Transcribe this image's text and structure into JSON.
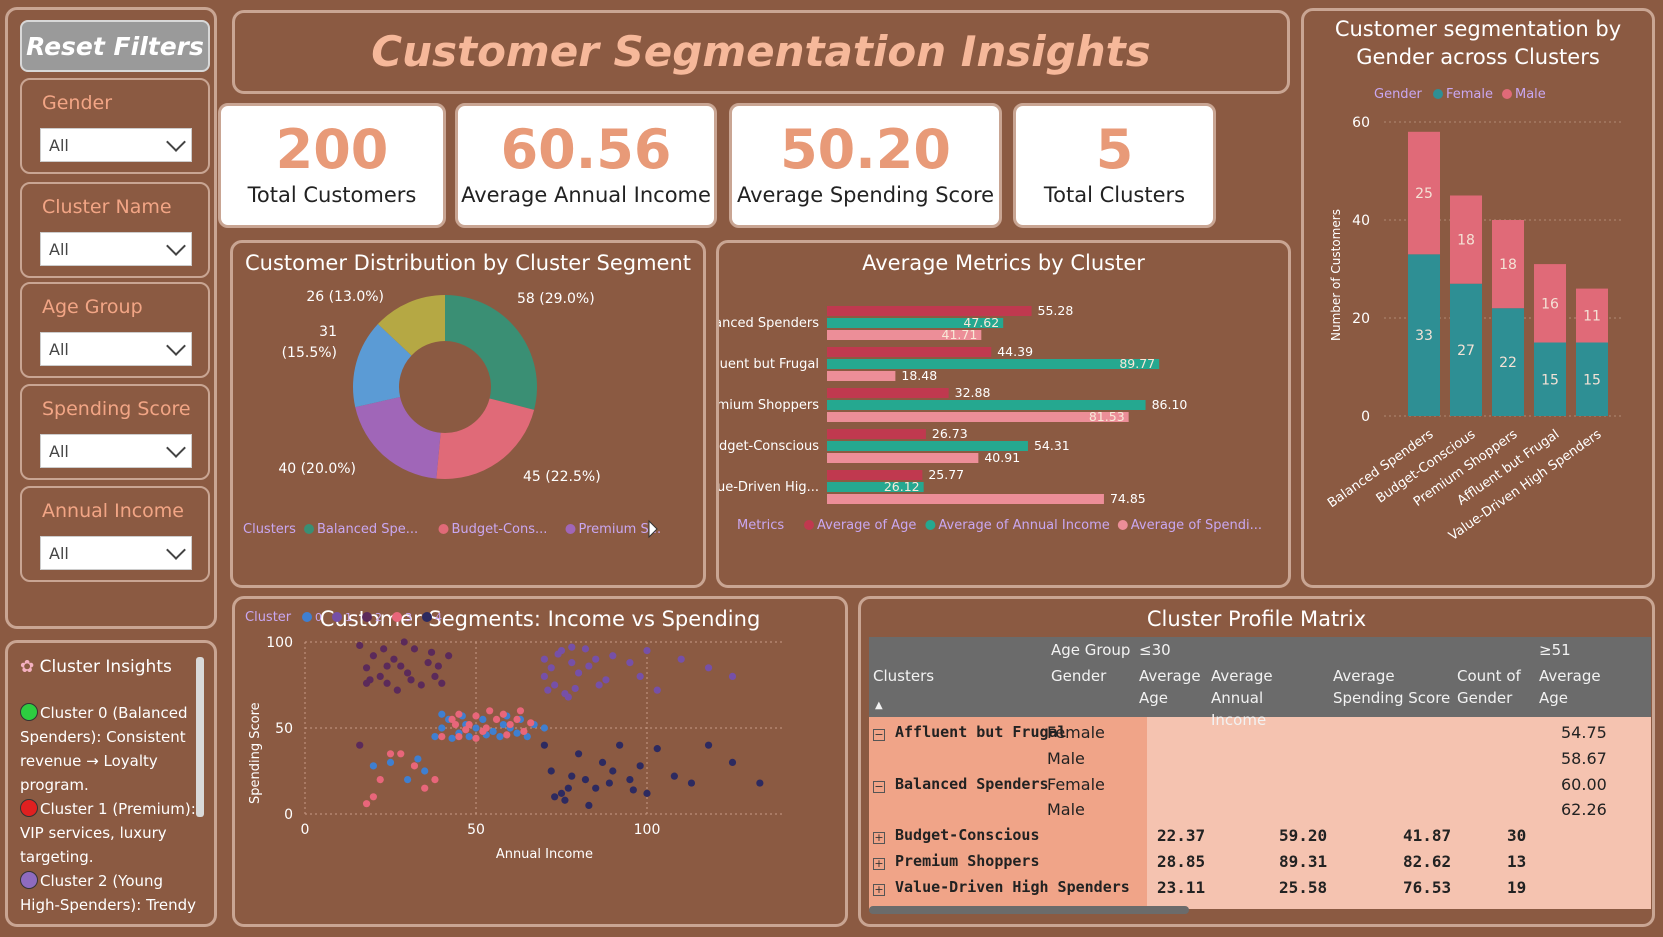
{
  "filters": {
    "reset_label": "Reset Filters",
    "items": [
      {
        "label": "Gender",
        "value": "All"
      },
      {
        "label": "Cluster Name",
        "value": "All"
      },
      {
        "label": "Age Group",
        "value": "All"
      },
      {
        "label": "Spending Score",
        "value": "All"
      },
      {
        "label": "Annual Income",
        "value": "All"
      }
    ]
  },
  "insights": {
    "title": "Cluster Insights",
    "lines": [
      {
        "color": "#2ECC40",
        "text": "Cluster 0 (Balanced Spenders): Consistent revenue → Loyalty program."
      },
      {
        "color": "#E02020",
        "text": "Cluster 1 (Premium): VIP services, luxury targeting."
      },
      {
        "color": "#8E6BBF",
        "text": "Cluster 2 (Young High-Spenders): Trendy"
      }
    ]
  },
  "header": {
    "title": "Customer Segmentation Insights"
  },
  "kpis": [
    {
      "value": "200",
      "caption": "Total Customers"
    },
    {
      "value": "60.56",
      "caption": "Average Annual Income"
    },
    {
      "value": "50.20",
      "caption": "Average Spending Score"
    },
    {
      "value": "5",
      "caption": "Total Clusters"
    }
  ],
  "donut": {
    "title": "Customer Distribution by Cluster Segment",
    "legend_title": "Clusters",
    "legend": [
      {
        "name": "Balanced Spe...",
        "color": "#3A8F74"
      },
      {
        "name": "Budget-Cons...",
        "color": "#E06A78"
      },
      {
        "name": "Premium S...",
        "color": "#A066B8"
      }
    ],
    "labels": [
      "58 (29.0%)",
      "45 (22.5%)",
      "40 (20.0%)",
      "31",
      "(15.5%)",
      "26 (13.0%)"
    ]
  },
  "metrics": {
    "title": "Average Metrics by Cluster",
    "legend_title": "Metrics",
    "legend": [
      {
        "name": "Average of Age",
        "color": "#C0394F"
      },
      {
        "name": "Average of Annual Income",
        "color": "#25A890"
      },
      {
        "name": "Average of Spendi...",
        "color": "#EC8E98"
      }
    ]
  },
  "stack": {
    "title_line1": "Customer segmentation by",
    "title_line2": "Gender across Clusters",
    "legend_title": "Gender",
    "female_label": "Female",
    "male_label": "Male",
    "ylabel": "Number of Customers"
  },
  "scatter": {
    "title": "Customer Segments: Income vs Spending",
    "legend_title": "Cluster",
    "xlabel": "Annual Income",
    "ylabel": "Spending Score"
  },
  "matrix": {
    "title": "Cluster Profile Matrix",
    "head": {
      "clusters": "Clusters",
      "age_group": "Age Group",
      "gender": "Gender",
      "age_le30": "≤30",
      "age_ge51": "≥51",
      "avg_age": "Average Age",
      "avg_income": "Average Annual Income",
      "avg_spending": "Average Spending Score",
      "count_gender": "Count of Gender",
      "avg_age2": "Average Age"
    },
    "rows": [
      {
        "cluster": "Affluent but Frugal",
        "gender": "Female",
        "age": "",
        "income": "",
        "spend": "",
        "count": "",
        "age51": "54.75"
      },
      {
        "cluster": "",
        "gender": "Male",
        "age": "",
        "income": "",
        "spend": "",
        "count": "",
        "age51": "58.67"
      },
      {
        "cluster": "Balanced Spenders",
        "gender": "Female",
        "age": "",
        "income": "",
        "spend": "",
        "count": "",
        "age51": "60.00"
      },
      {
        "cluster": "",
        "gender": "Male",
        "age": "",
        "income": "",
        "spend": "",
        "count": "",
        "age51": "62.26"
      },
      {
        "cluster": "Budget-Conscious",
        "gender": "",
        "age": "22.37",
        "income": "59.20",
        "spend": "41.87",
        "count": "30",
        "age51": ""
      },
      {
        "cluster": "Premium Shoppers",
        "gender": "",
        "age": "28.85",
        "income": "89.31",
        "spend": "82.62",
        "count": "13",
        "age51": ""
      },
      {
        "cluster": "Value-Driven High Spenders",
        "gender": "",
        "age": "23.11",
        "income": "25.58",
        "spend": "76.53",
        "count": "19",
        "age51": ""
      }
    ]
  },
  "chart_data": [
    {
      "type": "pie",
      "title": "Customer Distribution by Cluster Segment",
      "categories": [
        "Balanced Spenders",
        "Budget-Conscious",
        "Premium Shoppers",
        "Affluent but Frugal",
        "Value-Driven High Spenders"
      ],
      "values": [
        58,
        45,
        40,
        31,
        26
      ],
      "colors": [
        "#3A8F74",
        "#E06A78",
        "#A066B8",
        "#5B9BD5",
        "#B5A844"
      ]
    },
    {
      "type": "bar",
      "orientation": "horizontal",
      "title": "Average Metrics by Cluster",
      "categories": [
        "Balanced Spenders",
        "Affluent but Frugal",
        "Premium Shoppers",
        "Budget-Conscious",
        "Value-Driven Hig..."
      ],
      "series": [
        {
          "name": "Average of Age",
          "values": [
            55.28,
            44.39,
            32.88,
            26.73,
            25.77
          ]
        },
        {
          "name": "Average of Annual Income",
          "values": [
            47.62,
            89.77,
            86.1,
            54.31,
            26.12
          ]
        },
        {
          "name": "Average of Spendi...",
          "values": [
            41.71,
            18.48,
            81.53,
            40.91,
            74.85
          ]
        }
      ],
      "xlim": [
        0,
        100
      ]
    },
    {
      "type": "bar",
      "stacked": true,
      "title": "Customer segmentation by Gender across Clusters",
      "categories": [
        "Balanced Spenders",
        "Budget-Conscious",
        "Premium Shoppers",
        "Affluent but Frugal",
        "Value-Driven High Spenders"
      ],
      "series": [
        {
          "name": "Female",
          "values": [
            33,
            27,
            22,
            15,
            15
          ]
        },
        {
          "name": "Male",
          "values": [
            25,
            18,
            18,
            16,
            11
          ]
        }
      ],
      "ylabel": "Number of Customers",
      "ylim": [
        0,
        65
      ],
      "yticks": [
        0,
        20,
        40,
        60
      ]
    },
    {
      "type": "scatter",
      "title": "Customer Segments: Income vs Spending",
      "xlabel": "Annual Income",
      "ylabel": "Spending Score",
      "xlim": [
        0,
        140
      ],
      "ylim": [
        0,
        100
      ],
      "xticks": [
        0,
        50,
        100
      ],
      "yticks": [
        0,
        50,
        100
      ],
      "series": [
        {
          "name": "0",
          "color": "#3F7FD0",
          "points": [
            [
              40,
              50
            ],
            [
              42,
              55
            ],
            [
              45,
              47
            ],
            [
              47,
              52
            ],
            [
              48,
              45
            ],
            [
              50,
              50
            ],
            [
              52,
              55
            ],
            [
              55,
              48
            ],
            [
              57,
              45
            ],
            [
              58,
              52
            ],
            [
              60,
              50
            ],
            [
              62,
              47
            ],
            [
              63,
              55
            ],
            [
              65,
              45
            ],
            [
              67,
              52
            ],
            [
              70,
              50
            ],
            [
              38,
              45
            ],
            [
              20,
              28
            ],
            [
              25,
              30
            ],
            [
              30,
              20
            ],
            [
              33,
              32
            ],
            [
              35,
              25
            ],
            [
              40,
              58
            ],
            [
              43,
              44
            ],
            [
              46,
              57
            ],
            [
              53,
              46
            ],
            [
              59,
              57
            ]
          ]
        },
        {
          "name": "1",
          "color": "#7650A8",
          "points": [
            [
              70,
              90
            ],
            [
              72,
              85
            ],
            [
              75,
              95
            ],
            [
              73,
              75
            ],
            [
              76,
              70
            ],
            [
              78,
              88
            ],
            [
              80,
              82
            ],
            [
              82,
              96
            ],
            [
              85,
              90
            ],
            [
              88,
              78
            ],
            [
              70,
              80
            ],
            [
              74,
              93
            ],
            [
              77,
              68
            ],
            [
              79,
              73
            ],
            [
              83,
              86
            ],
            [
              86,
              75
            ],
            [
              90,
              92
            ],
            [
              95,
              88
            ],
            [
              100,
              95
            ],
            [
              98,
              80
            ],
            [
              103,
              72
            ],
            [
              110,
              90
            ],
            [
              118,
              85
            ],
            [
              125,
              80
            ],
            [
              78,
              97
            ],
            [
              71,
              72
            ]
          ]
        },
        {
          "name": "2",
          "color": "#5B2A5A",
          "points": [
            [
              16,
              98
            ],
            [
              18,
              85
            ],
            [
              20,
              92
            ],
            [
              22,
              80
            ],
            [
              24,
              76
            ],
            [
              26,
              90
            ],
            [
              28,
              86
            ],
            [
              30,
              82
            ],
            [
              32,
              96
            ],
            [
              34,
              75
            ],
            [
              36,
              88
            ],
            [
              38,
              80
            ],
            [
              40,
              76
            ],
            [
              42,
              92
            ],
            [
              16,
              40
            ],
            [
              19,
              78
            ],
            [
              23,
              96
            ],
            [
              27,
              72
            ],
            [
              31,
              78
            ],
            [
              37,
              94
            ],
            [
              39,
              86
            ],
            [
              24,
              86
            ],
            [
              18,
              76
            ],
            [
              29,
              100
            ]
          ]
        },
        {
          "name": "3",
          "color": "#E8667A",
          "points": [
            [
              18,
              6
            ],
            [
              20,
              10
            ],
            [
              22,
              20
            ],
            [
              25,
              35
            ],
            [
              28,
              35
            ],
            [
              32,
              28
            ],
            [
              35,
              15
            ],
            [
              38,
              20
            ],
            [
              40,
              45
            ],
            [
              43,
              55
            ],
            [
              45,
              58
            ],
            [
              48,
              52
            ],
            [
              50,
              57
            ],
            [
              53,
              50
            ],
            [
              56,
              55
            ],
            [
              58,
              58
            ],
            [
              60,
              52
            ],
            [
              62,
              55
            ],
            [
              64,
              48
            ],
            [
              66,
              53
            ],
            [
              45,
              45
            ],
            [
              50,
              44
            ],
            [
              54,
              60
            ],
            [
              59,
              46
            ],
            [
              63,
              60
            ],
            [
              52,
              48
            ],
            [
              47,
              49
            ],
            [
              44,
              52
            ]
          ]
        },
        {
          "name": "4",
          "color": "#2D2A60",
          "points": [
            [
              70,
              40
            ],
            [
              72,
              25
            ],
            [
              75,
              12
            ],
            [
              77,
              15
            ],
            [
              78,
              22
            ],
            [
              80,
              35
            ],
            [
              82,
              20
            ],
            [
              85,
              15
            ],
            [
              87,
              30
            ],
            [
              90,
              25
            ],
            [
              92,
              40
            ],
            [
              95,
              20
            ],
            [
              98,
              28
            ],
            [
              100,
              12
            ],
            [
              103,
              38
            ],
            [
              108,
              22
            ],
            [
              113,
              18
            ],
            [
              118,
              40
            ],
            [
              125,
              30
            ],
            [
              133,
              18
            ],
            [
              73,
              10
            ],
            [
              76,
              8
            ],
            [
              83,
              5
            ],
            [
              89,
              18
            ],
            [
              96,
              14
            ]
          ]
        }
      ]
    }
  ]
}
